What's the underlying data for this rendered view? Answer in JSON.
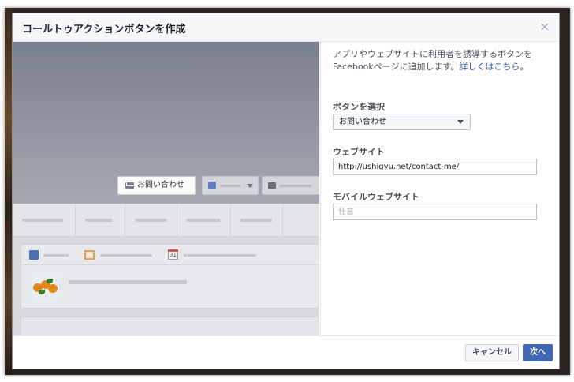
{
  "dialog": {
    "title": "コールトゥアクションボタンを作成",
    "close_glyph": "×"
  },
  "preview": {
    "cta_label": "お問い合わせ",
    "calendar_day": "31"
  },
  "form": {
    "description": "アプリやウェブサイトに利用者を誘導するボタンをFacebookページに追加します。",
    "learn_more": "詳しくはこちら",
    "description_end": "。",
    "button_label": "ボタンを選択",
    "button_value": "お問い合わせ",
    "website_label": "ウェブサイト",
    "website_value": "http://ushigyu.net/contact-me/",
    "mobile_label": "モバイルウェブサイト",
    "mobile_placeholder": "任意"
  },
  "footer": {
    "cancel_label": "キャンセル",
    "next_label": "次へ"
  },
  "colors": {
    "primary": "#4267b2",
    "link": "#365899"
  }
}
